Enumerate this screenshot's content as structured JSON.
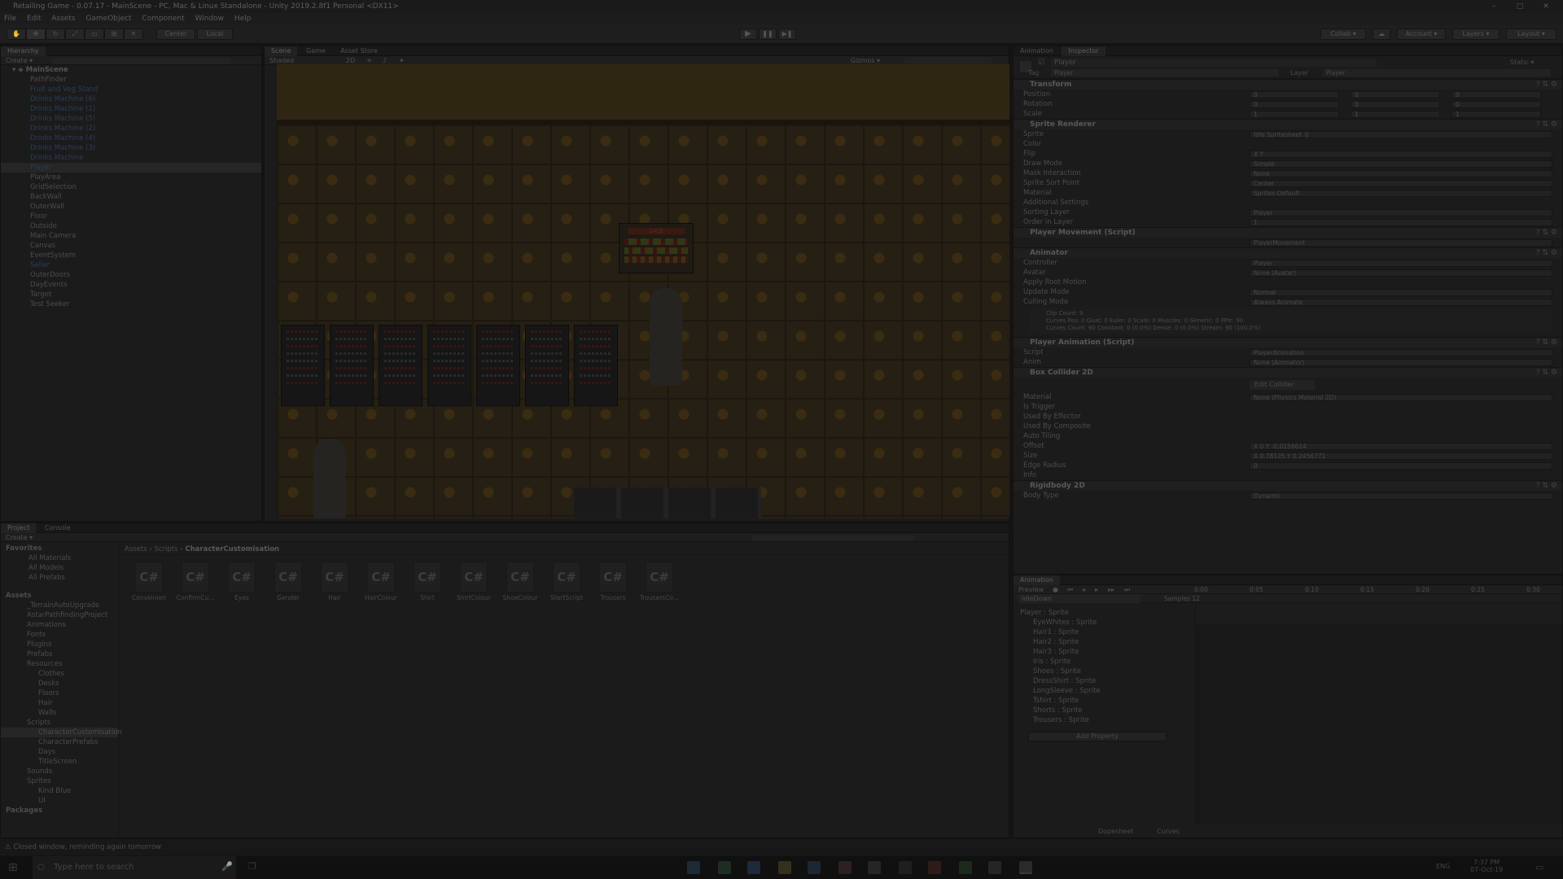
{
  "window": {
    "title": "Retailing Game - 0.07.17 - MainScene - PC, Mac & Linux Standalone - Unity 2019.2.8f1 Personal <DX11>",
    "minimize": "–",
    "maximize": "□",
    "close": "✕"
  },
  "menu": [
    "File",
    "Edit",
    "Assets",
    "GameObject",
    "Component",
    "Window",
    "Help"
  ],
  "toolbar": {
    "center": "Center",
    "local": "Local",
    "play": "▶",
    "pause": "❚❚",
    "step": "▶❚",
    "collab": "Collab ▾",
    "account": "Account ▾",
    "layers": "Layers ▾",
    "layout": "Layout ▾"
  },
  "hierarchy": {
    "tab": "Hierarchy",
    "create": "Create ▾",
    "search_placeholder": "All",
    "scene": "MainScene",
    "items": [
      {
        "label": "PathFinder",
        "blue": false
      },
      {
        "label": "Fruit and Veg Stand",
        "blue": true
      },
      {
        "label": "Drinks Machine (6)",
        "blue": true
      },
      {
        "label": "Drinks Machine (1)",
        "blue": true
      },
      {
        "label": "Drinks Machine (5)",
        "blue": true
      },
      {
        "label": "Drinks Machine (2)",
        "blue": true
      },
      {
        "label": "Drinks Machine (4)",
        "blue": true
      },
      {
        "label": "Drinks Machine (3)",
        "blue": true
      },
      {
        "label": "Drinks Machine",
        "blue": true
      },
      {
        "label": "Player",
        "blue": true,
        "selected": true
      },
      {
        "label": "PlayArea",
        "blue": false
      },
      {
        "label": "GridSelection",
        "blue": false
      },
      {
        "label": "BackWall",
        "blue": false
      },
      {
        "label": "OuterWall",
        "blue": false
      },
      {
        "label": "Floor",
        "blue": false
      },
      {
        "label": "Outside",
        "blue": false
      },
      {
        "label": "Main Camera",
        "blue": false
      },
      {
        "label": "Canvas",
        "blue": false
      },
      {
        "label": "EventSystem",
        "blue": false
      },
      {
        "label": "Seller",
        "blue": true
      },
      {
        "label": "OuterDoors",
        "blue": false
      },
      {
        "label": "DayEvents",
        "blue": false
      },
      {
        "label": "Target",
        "blue": false
      },
      {
        "label": "Test Seeker",
        "blue": false
      }
    ]
  },
  "scene_view": {
    "tabs": [
      "Scene",
      "Game",
      "Asset Store"
    ],
    "shading": "Shaded",
    "mode_2d": "2D",
    "gizmos": "Gizmos ▾",
    "search_placeholder": "All",
    "sale_sign": "SALE"
  },
  "project": {
    "tabs": [
      "Project",
      "Console"
    ],
    "create": "Create ▾",
    "breadcrumb": [
      "Assets",
      "Scripts",
      "CharacterCustomisation"
    ],
    "favorites_label": "Favorites",
    "favorites": [
      "All Materials",
      "All Models",
      "All Prefabs"
    ],
    "assets_label": "Assets",
    "assets_tree": [
      {
        "label": "_TerrainAutoUpgrade",
        "depth": 1
      },
      {
        "label": "AstarPathfindingProject",
        "depth": 1
      },
      {
        "label": "Animations",
        "depth": 1
      },
      {
        "label": "Fonts",
        "depth": 1
      },
      {
        "label": "Plugins",
        "depth": 1
      },
      {
        "label": "Prefabs",
        "depth": 1
      },
      {
        "label": "Resources",
        "depth": 1
      },
      {
        "label": "Clothes",
        "depth": 2
      },
      {
        "label": "Desks",
        "depth": 2
      },
      {
        "label": "Floors",
        "depth": 2
      },
      {
        "label": "Hair",
        "depth": 2
      },
      {
        "label": "Walls",
        "depth": 2
      },
      {
        "label": "Scripts",
        "depth": 1
      },
      {
        "label": "CharacterCustomisation",
        "depth": 2,
        "selected": true
      },
      {
        "label": "CharacterPrefabs",
        "depth": 2
      },
      {
        "label": "Days",
        "depth": 2
      },
      {
        "label": "TitleScreen",
        "depth": 2
      },
      {
        "label": "Sounds",
        "depth": 1
      },
      {
        "label": "Sprites",
        "depth": 1
      },
      {
        "label": "Kind Blue",
        "depth": 2
      },
      {
        "label": "UI",
        "depth": 2
      }
    ],
    "packages_label": "Packages",
    "files": [
      "Conveinien",
      "ConfirmCu...",
      "Eyes",
      "Gender",
      "Hair",
      "HairColour",
      "Shirt",
      "ShirtColour",
      "ShoeColour",
      "StartScript",
      "Trousers",
      "TrousersCo..."
    ],
    "file_icon": "C#"
  },
  "inspector": {
    "tabs": [
      "Animation",
      "Inspector"
    ],
    "object_name": "Player",
    "static_label": "Static ▾",
    "tag_label": "Tag",
    "tag_value": "Player",
    "layer_label": "Layer",
    "layer_value": "Player",
    "transform": {
      "title": "Transform",
      "rows": [
        {
          "label": "Position",
          "x": "0",
          "y": "0",
          "z": "0"
        },
        {
          "label": "Rotation",
          "x": "0",
          "y": "0",
          "z": "0"
        },
        {
          "label": "Scale",
          "x": "1",
          "y": "1",
          "z": "1"
        }
      ]
    },
    "sprite_renderer": {
      "title": "Sprite Renderer",
      "rows": [
        {
          "label": "Sprite",
          "value": "Idle Spritesheet_0"
        },
        {
          "label": "Color",
          "value": ""
        },
        {
          "label": "Flip",
          "value": "X  Y"
        },
        {
          "label": "Draw Mode",
          "value": "Simple"
        },
        {
          "label": "Mask Interaction",
          "value": "None"
        },
        {
          "label": "Sprite Sort Point",
          "value": "Center"
        },
        {
          "label": "Material",
          "value": "Sprites-Default"
        },
        {
          "label": "Additional Settings",
          "value": ""
        },
        {
          "label": "Sorting Layer",
          "value": "Player"
        },
        {
          "label": "Order in Layer",
          "value": "1"
        }
      ]
    },
    "player_movement": {
      "title": "Player Movement (Script)",
      "script": "PlayerMovement"
    },
    "animator": {
      "title": "Animator",
      "rows": [
        {
          "label": "Controller",
          "value": "Player"
        },
        {
          "label": "Avatar",
          "value": "None (Avatar)"
        },
        {
          "label": "Apply Root Motion",
          "value": ""
        },
        {
          "label": "Update Mode",
          "value": "Normal"
        },
        {
          "label": "Culling Mode",
          "value": "Always Animate"
        }
      ],
      "info": [
        "Clip Count: 9",
        "Curves Pos: 0 Quat: 0 Euler: 0 Scale: 0 Muscles: 0 Generic: 0 PPtr: 90",
        "Curves Count: 90 Constant: 0 (0.0%) Dense: 0 (0.0%) Stream: 90 (100.0%)"
      ]
    },
    "player_animation": {
      "title": "Player Animation (Script)",
      "rows": [
        {
          "label": "Script",
          "value": "PlayerAnimation"
        },
        {
          "label": "Anim",
          "value": "None (Animator)"
        }
      ]
    },
    "box_collider": {
      "title": "Box Collider 2D",
      "edit_collider": "Edit Collider",
      "rows": [
        {
          "label": "Material",
          "value": "None (Physics Material 2D)"
        },
        {
          "label": "Is Trigger",
          "value": ""
        },
        {
          "label": "Used By Effector",
          "value": ""
        },
        {
          "label": "Used By Composite",
          "value": ""
        },
        {
          "label": "Auto Tiling",
          "value": ""
        },
        {
          "label": "Offset",
          "value": "X  0        Y  -0.0156614"
        },
        {
          "label": "Size",
          "value": "X  0.78125   Y  0.2456771"
        },
        {
          "label": "Edge Radius",
          "value": "0"
        },
        {
          "label": "Info",
          "value": ""
        }
      ]
    },
    "rigidbody": {
      "title": "Rigidbody 2D",
      "body_type_label": "Body Type",
      "body_type": "Dynamic"
    }
  },
  "animation": {
    "tab": "Animation",
    "preview": "Preview",
    "clip": "IdleDown",
    "samples": "Samples 12",
    "ruler": [
      "0:00",
      "0:05",
      "0:10",
      "0:15",
      "0:20",
      "0:25",
      "0:30"
    ],
    "properties": [
      "Player : Sprite",
      "EyeWhites : Sprite",
      "Hair1 : Sprite",
      "Hair2 : Sprite",
      "Hair3 : Sprite",
      "Iris : Sprite",
      "Shoes : Sprite",
      "DressShirt : Sprite",
      "LongSleeve : Sprite",
      "Tshirt : Sprite",
      "Shorts : Sprite",
      "Trousers : Sprite"
    ],
    "add_property": "Add Property",
    "dopesheet": "Dopesheet",
    "curves": "Curves"
  },
  "status_bar": "Closed window, reminding again tomorrow",
  "taskbar": {
    "search_placeholder": "Type here to search",
    "time": "7:37 PM",
    "date": "07-Oct-19",
    "lang": "ENG"
  },
  "colors": {
    "accent": "#2b3d55",
    "floor": "#2a2215",
    "shelf": "#161616"
  }
}
